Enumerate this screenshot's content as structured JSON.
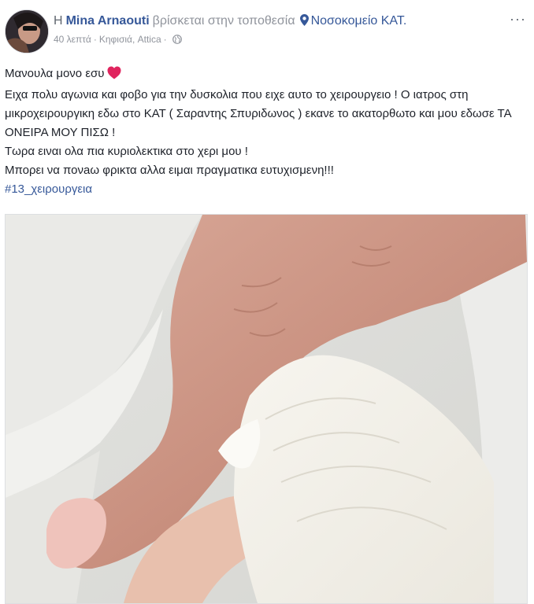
{
  "post": {
    "author_prefix": "Η",
    "author_name": "Mina Arnaouti",
    "location_text": "βρίσκεται στην τοποθεσία",
    "place_name": "Νοσοκομείο ΚΑΤ.",
    "time": "40 λεπτά",
    "separator": "·",
    "city": "Κηφισιά, Attica",
    "more_label": "···",
    "lines": [
      "Μανουλα μονο εσυ",
      "Ειχα πολυ αγωνια και φοβο για την δυσκολια που ειχε αυτο το χειρουργειο ! Ο ιατρος στη μικροχειρουργικη εδω στο ΚΑΤ ( Σαραντης Σπυριδωνος ) εκανε το ακατορθωτο και μου εδωσε ΤΑ ΟΝΕΙΡΑ ΜΟΥ ΠΙΣΩ !",
      "Τωρα ειναι ολα πια κυριολεκτικα στο χερι μου !",
      "Μπορει να πονaω φρικτα αλλα ειμαι πραγματικα ευτυχισμενη!!!"
    ],
    "hashtag": "#13_χειρουργεια"
  },
  "colors": {
    "link": "#365899",
    "meta": "#90949c",
    "text": "#1d2129",
    "heart": "#e0245e"
  },
  "icons": {
    "place": "location-pin-icon",
    "privacy": "globe-icon",
    "emoji": "heart-icon"
  }
}
